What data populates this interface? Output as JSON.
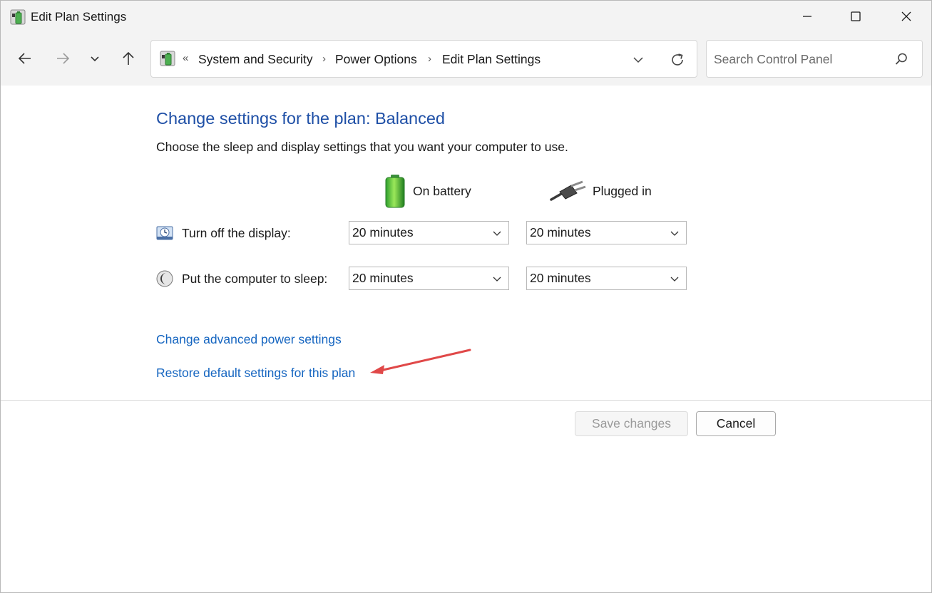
{
  "window": {
    "title": "Edit Plan Settings",
    "controls": {
      "minimize": "minimize-icon",
      "maximize": "maximize-icon",
      "close": "close-icon"
    }
  },
  "nav": {
    "back": "back-arrow-icon",
    "forward": "forward-arrow-icon",
    "recent": "chevron-down-icon",
    "up": "up-arrow-icon"
  },
  "address": {
    "overflow": "«",
    "crumbs": [
      "System and Security",
      "Power Options",
      "Edit Plan Settings"
    ],
    "separator": "›"
  },
  "search": {
    "placeholder": "Search Control Panel"
  },
  "main": {
    "heading": "Change settings for the plan: Balanced",
    "description": "Choose the sleep and display settings that you want your computer to use.",
    "columns": {
      "battery": "On battery",
      "plugged": "Plugged in"
    },
    "rows": [
      {
        "label": "Turn off the display:",
        "battery": "20 minutes",
        "plugged": "20 minutes"
      },
      {
        "label": "Put the computer to sleep:",
        "battery": "20 minutes",
        "plugged": "20 minutes"
      }
    ],
    "links": {
      "advanced": "Change advanced power settings",
      "restore": "Restore default settings for this plan"
    }
  },
  "buttons": {
    "save": "Save changes",
    "cancel": "Cancel"
  },
  "colors": {
    "heading": "#1e4fa6",
    "link": "#1565c0",
    "annotation_arrow": "#e04848"
  }
}
